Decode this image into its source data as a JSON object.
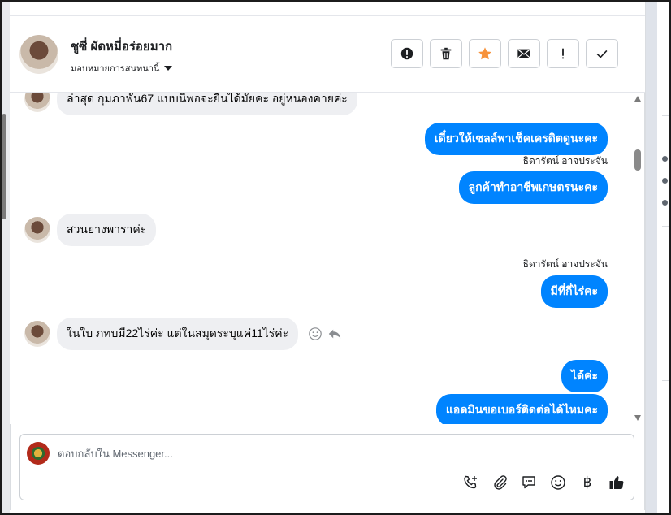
{
  "header": {
    "contact_name": "ชูซี่ ผัดหมี่อร่อยมาก",
    "assign_label": "มอบหมายการสนทนานี้"
  },
  "actions": [
    {
      "icon": "alert-circle-icon"
    },
    {
      "icon": "trash-icon"
    },
    {
      "icon": "star-icon",
      "color": "#f7923a"
    },
    {
      "icon": "envelope-icon"
    },
    {
      "icon": "exclamation-icon"
    },
    {
      "icon": "check-icon"
    }
  ],
  "messages": {
    "m1": "ล่าสุด กุมภาพัน67 แบบนี้พอจะยื่นได้มั้ยคะ อยู่หนองคายค่ะ",
    "m2": "เดี๋ยวให้เซลล์พาเช็คเครดิตดูนะคะ",
    "sender1": "ธิดารัตน์ อาจประจัน",
    "m3": "ลูกค้าทำอาชีพเกษตรนะคะ",
    "m4": "สวนยางพาราค่ะ",
    "sender2": "ธิดารัตน์ อาจประจัน",
    "m5": "มีที่กี่ไร่คะ",
    "m6": "ในใบ ภทบมี22ไร่ค่ะ แต่ในสมุดระบุแค่11ไร่ค่ะ",
    "m7": "ได้ค่ะ",
    "m8": "แอดมินขอเบอร์ติดต่อได้ไหมคะ"
  },
  "composer": {
    "placeholder": "ตอบกลับใน Messenger...",
    "tools": [
      "phone-add-icon",
      "paperclip-icon",
      "chat-bubble-icon",
      "smiley-icon",
      "baht-icon",
      "thumbs-up-icon"
    ],
    "baht_symbol": "฿"
  },
  "colors": {
    "outgoing": "#0084ff",
    "incoming": "#eeeff2",
    "star": "#f7923a"
  }
}
